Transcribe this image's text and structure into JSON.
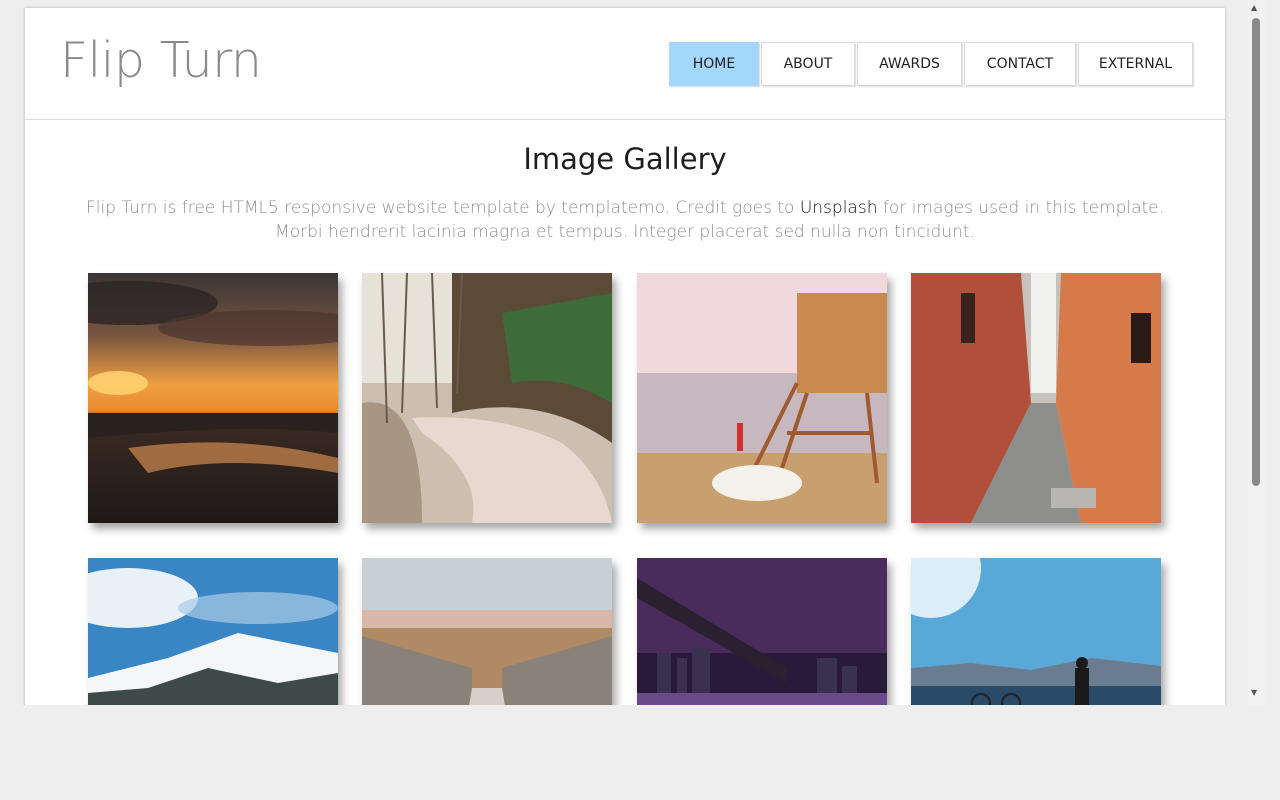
{
  "site": {
    "title": "Flip Turn"
  },
  "nav": {
    "items": [
      {
        "label": "HOME",
        "active": true
      },
      {
        "label": "ABOUT",
        "active": false
      },
      {
        "label": "AWARDS",
        "active": false
      },
      {
        "label": "CONTACT",
        "active": false
      },
      {
        "label": "EXTERNAL",
        "active": false
      }
    ]
  },
  "gallery": {
    "title": "Image Gallery",
    "intro_before": "Flip Turn is free HTML5 responsive website template by templatemo. Credit goes to ",
    "intro_link": "Unsplash",
    "intro_after": " for images used in this template. Morbi hendrerit lacinia magna et tempus. Integer placerat sed nulla non tincidunt.",
    "images": [
      {
        "subject": "sunset-beach"
      },
      {
        "subject": "forest-road"
      },
      {
        "subject": "lifeguard-tower"
      },
      {
        "subject": "narrow-alley"
      },
      {
        "subject": "snowy-mountains"
      },
      {
        "subject": "wooden-bridge"
      },
      {
        "subject": "city-bridge-night"
      },
      {
        "subject": "man-with-bicycle"
      }
    ]
  },
  "colors": {
    "nav_active": "#a3d8fc",
    "title_gray": "#8a8a8a",
    "text_gray": "#8f8f8f"
  },
  "icons": {
    "scroll_up": "scroll-up-arrow-icon",
    "scroll_down": "scroll-down-arrow-icon"
  }
}
